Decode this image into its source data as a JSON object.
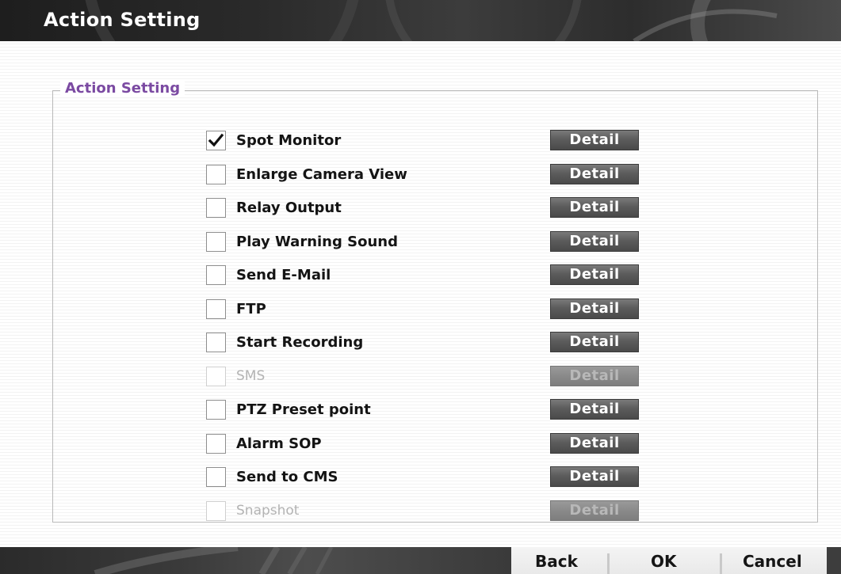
{
  "window": {
    "title": "Action Setting"
  },
  "group": {
    "title": "Action Setting"
  },
  "actions": [
    {
      "label": "Spot Monitor",
      "checked": true,
      "enabled": true,
      "button": "Detail"
    },
    {
      "label": "Enlarge Camera View",
      "checked": false,
      "enabled": true,
      "button": "Detail"
    },
    {
      "label": "Relay Output",
      "checked": false,
      "enabled": true,
      "button": "Detail"
    },
    {
      "label": "Play Warning Sound",
      "checked": false,
      "enabled": true,
      "button": "Detail"
    },
    {
      "label": "Send E-Mail",
      "checked": false,
      "enabled": true,
      "button": "Detail"
    },
    {
      "label": "FTP",
      "checked": false,
      "enabled": true,
      "button": "Detail"
    },
    {
      "label": "Start Recording",
      "checked": false,
      "enabled": true,
      "button": "Detail"
    },
    {
      "label": "SMS",
      "checked": false,
      "enabled": false,
      "button": "Detail"
    },
    {
      "label": "PTZ Preset point",
      "checked": false,
      "enabled": true,
      "button": "Detail"
    },
    {
      "label": "Alarm SOP",
      "checked": false,
      "enabled": true,
      "button": "Detail"
    },
    {
      "label": "Send to CMS",
      "checked": false,
      "enabled": true,
      "button": "Detail"
    },
    {
      "label": "Snapshot",
      "checked": false,
      "enabled": false,
      "button": "Detail"
    }
  ],
  "footer": {
    "back_label": "Back",
    "ok_label": "OK",
    "cancel_label": "Cancel"
  },
  "colors": {
    "group_title": "#7b4aa2",
    "title_text": "#ffffff",
    "detail_button": "#5c5c5c",
    "disabled_text": "#b3b3b3"
  },
  "icons": {
    "checkmark": "check-icon"
  }
}
